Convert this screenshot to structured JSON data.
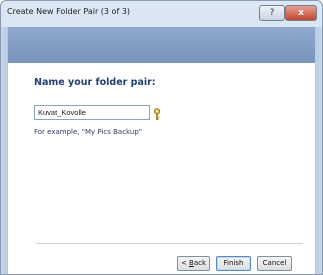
{
  "window": {
    "title": "Create New Folder Pair (3 of 3)",
    "help_label": "?",
    "close_label": "x"
  },
  "main": {
    "heading": "Name your folder pair:",
    "name_field_value": "Kuvat_Kovolle",
    "hint": "For example, \"My Pics Backup\"",
    "hint_icon": "key-icon"
  },
  "buttons": {
    "back_prefix": "< ",
    "back_mnemonic": "B",
    "back_rest": "ack",
    "finish": "Finish",
    "cancel": "Cancel"
  },
  "colors": {
    "header_band": "#7893bc",
    "heading_text": "#1f3f77",
    "close_button": "#c4452c"
  }
}
